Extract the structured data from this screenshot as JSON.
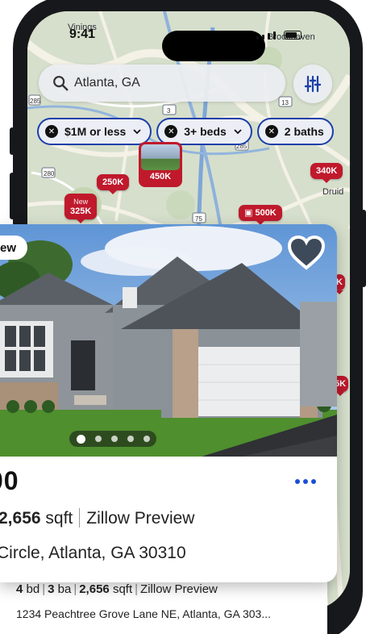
{
  "status": {
    "time": "9:41"
  },
  "map": {
    "labels": [
      "Vinings",
      "Brookhaven",
      "Druid"
    ],
    "route_shields": [
      "285",
      "3",
      "13",
      "285",
      "280",
      "75"
    ],
    "pins": [
      {
        "label": "250K"
      },
      {
        "label": "450K"
      },
      {
        "label": "325K",
        "tag": "New"
      },
      {
        "label": "500K",
        "icon": "3d-tour-icon"
      },
      {
        "label": "340K"
      },
      {
        "label": "K"
      },
      {
        "label": "5K"
      }
    ]
  },
  "search": {
    "value": "Atlanta, GA"
  },
  "filters": [
    {
      "label": "$1M or less"
    },
    {
      "label": "3+ beds"
    },
    {
      "label": "2 baths"
    }
  ],
  "listing": {
    "badge": "ew",
    "price": "00",
    "sqft_value": "2,656",
    "sqft_unit": "sqft",
    "source": "Zillow Preview",
    "address": "Circle, Atlanta, GA 30310",
    "photo_count": 5,
    "active_photo": 0
  },
  "next_listing": {
    "beds_value": "4",
    "beds_unit": "bd",
    "baths_value": "3",
    "baths_unit": "ba",
    "sqft_value": "2,656",
    "sqft_unit": "sqft",
    "source": "Zillow Preview",
    "address": "1234 Peachtree Grove Lane NE, Atlanta, GA 303..."
  },
  "colors": {
    "pin": "#c0192c",
    "accent": "#1b3fa8",
    "more": "#1b4fd8"
  }
}
